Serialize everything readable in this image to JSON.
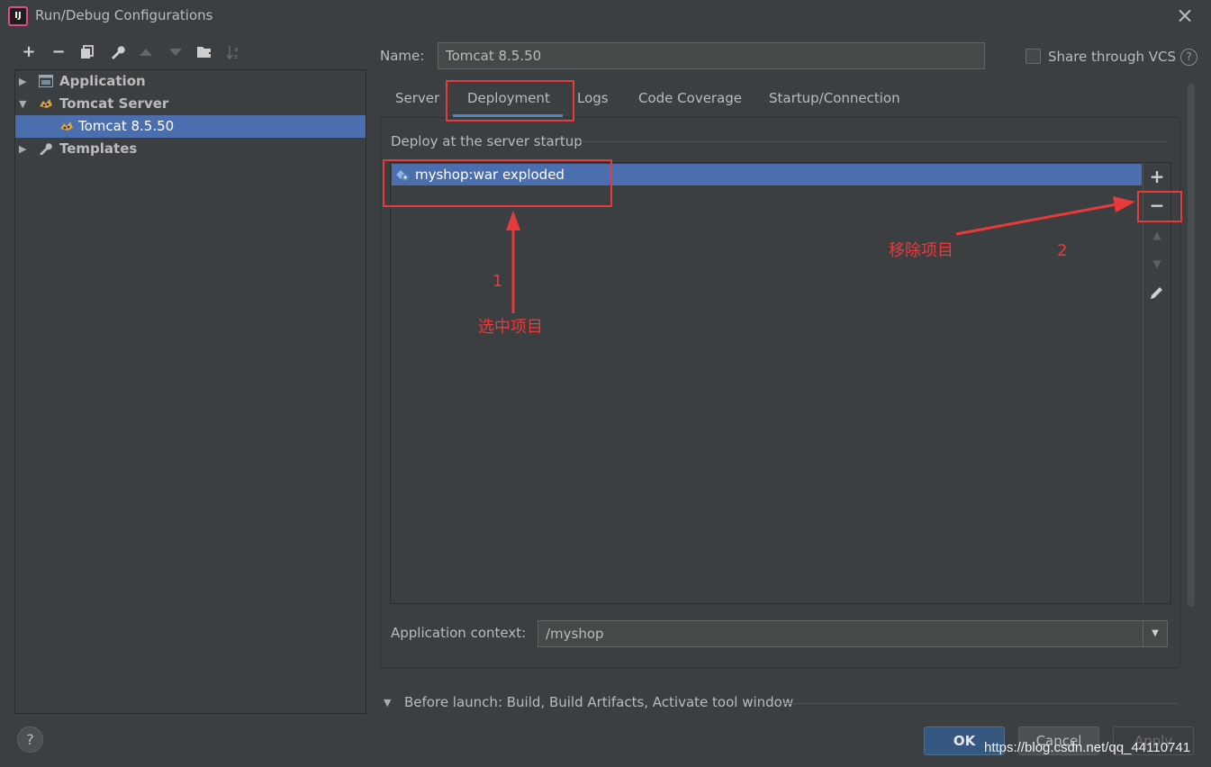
{
  "window": {
    "title": "Run/Debug Configurations",
    "app_icon": "intellij-icon"
  },
  "toolbar": {
    "icons": [
      "plus-icon",
      "minus-icon",
      "copy-icon",
      "wrench-icon",
      "arrow-up-icon",
      "arrow-down-icon",
      "folder-add-icon",
      "sort-icon"
    ]
  },
  "tree": {
    "items": [
      {
        "label": "Application",
        "icon": "application-icon"
      },
      {
        "label": "Tomcat Server",
        "icon": "tomcat-icon"
      },
      {
        "label": "Tomcat 8.5.50",
        "icon": "tomcat-icon"
      },
      {
        "label": "Templates",
        "icon": "wrench-icon"
      }
    ]
  },
  "config": {
    "name_label": "Name:",
    "name_value": "Tomcat 8.5.50",
    "share_vcs_label": "Share through VCS",
    "share_vcs_checked": false
  },
  "tabs": [
    {
      "label": "Server"
    },
    {
      "label": "Deployment",
      "active": true
    },
    {
      "label": "Logs"
    },
    {
      "label": "Code Coverage"
    },
    {
      "label": "Startup/Connection"
    }
  ],
  "deployment": {
    "group_title": "Deploy at the server startup",
    "artifacts": [
      {
        "label": "myshop:war exploded",
        "selected": true
      }
    ],
    "side_buttons": [
      "plus-icon",
      "minus-icon",
      "arrow-up-icon",
      "arrow-down-icon",
      "pencil-icon"
    ],
    "context_label": "Application context:",
    "context_value": "/myshop"
  },
  "before_launch": {
    "label": "Before launch: Build, Build Artifacts, Activate tool window"
  },
  "buttons": {
    "help": "?",
    "ok": "OK",
    "cancel": "Cancel",
    "apply": "Apply"
  },
  "annotations": {
    "num1": "1",
    "select_text": "选中项目",
    "num2": "2",
    "remove_text": "移除项目",
    "color": "#e83a3a"
  },
  "watermark": "https://blog.csdn.net/qq_44110741",
  "colors": {
    "selection": "#4b6eaf",
    "background": "#3c3f41",
    "tab_underline": "#4a88c7"
  }
}
